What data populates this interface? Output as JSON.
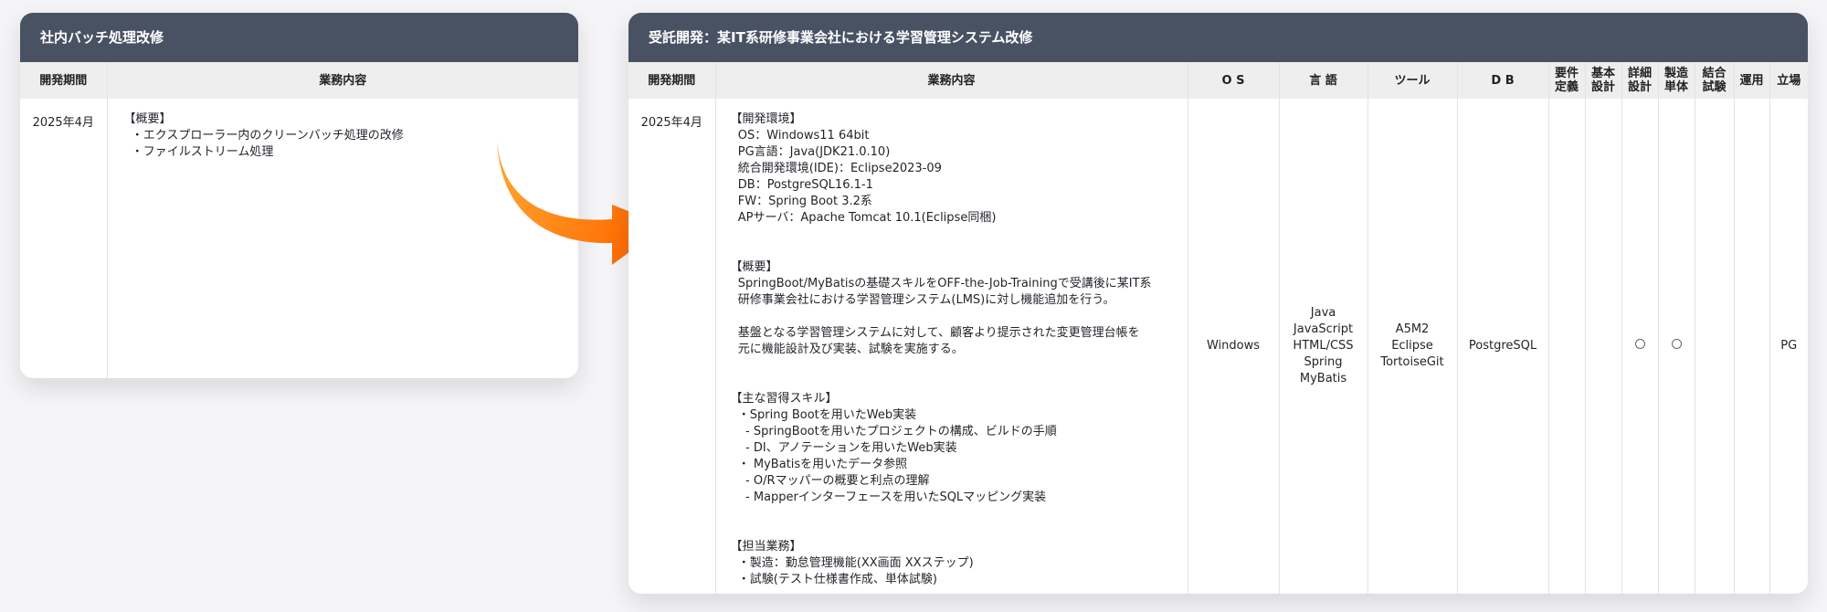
{
  "left_card": {
    "title": "社内バッチ処理改修",
    "headers": {
      "period": "開発期間",
      "content": "業務内容"
    },
    "row": {
      "period": "2025年4月",
      "content": "【概要】\n  ・エクスプローラー内のクリーンバッチ処理の改修\n  ・ファイルストリーム処理"
    }
  },
  "right_card": {
    "title": "受託開発：某IT系研修事業会社における学習管理システム改修",
    "headers": {
      "period": "開発期間",
      "content": "業務内容",
      "os": "O S",
      "language": "言 語",
      "tool": "ツール",
      "db": "D B",
      "phases": [
        {
          "l1": "要件",
          "l2": "定義"
        },
        {
          "l1": "基本",
          "l2": "設計"
        },
        {
          "l1": "詳細",
          "l2": "設計"
        },
        {
          "l1": "製造",
          "l2": "単体"
        },
        {
          "l1": "結合",
          "l2": "試験"
        },
        {
          "l1": "運用",
          "l2": ""
        },
        {
          "l1": "立場",
          "l2": ""
        }
      ]
    },
    "row": {
      "period": "2025年4月",
      "content": "【開発環境】\n  OS：Windows11 64bit\n  PG言語：Java(JDK21.0.10)\n  統合開発環境(IDE)：Eclipse2023-09\n  DB：PostgreSQL16.1-1\n  FW：Spring Boot 3.2系\n  APサーバ：Apache Tomcat 10.1(Eclipse同梱)\n\n\n【概要】\n  SpringBoot/MyBatisの基礎スキルをOFF-the-Job-Trainingで受講後に某IT系\n  研修事業会社における学習管理システム(LMS)に対し機能追加を行う。\n\n  基盤となる学習管理システムに対して、顧客より提示された変更管理台帳を\n  元に機能設計及び実装、試験を実施する。\n\n\n【主な習得スキル】\n  ・Spring Bootを用いたWeb実装\n    - SpringBootを用いたプロジェクトの構成、ビルドの手順\n    - DI、アノテーションを用いたWeb実装\n  ・ MyBatisを用いたデータ参照\n    - O/Rマッパーの概要と利点の理解\n    - Mapperインターフェースを用いたSQLマッピング実装\n\n\n【担当業務】\n  ・製造：勤怠管理機能(XX画面 XXステップ)\n  ・試験(テスト仕様書作成、単体試験)",
      "os": "Windows",
      "languages": [
        "Java",
        "JavaScript",
        "HTML/CSS",
        "Spring",
        "MyBatis"
      ],
      "tools": [
        "A5M2",
        "Eclipse",
        "TortoiseGit"
      ],
      "db": "PostgreSQL",
      "phases": [
        false,
        false,
        true,
        true,
        false,
        false
      ],
      "role": "PG"
    }
  },
  "icons": {
    "arrow": "curved-arrow-right-icon",
    "check": "circle-mark-icon"
  },
  "colors": {
    "header": "#495263",
    "subheader": "#eeeeee",
    "arrow_start": "#ffa733",
    "arrow_end": "#ff6a00"
  }
}
